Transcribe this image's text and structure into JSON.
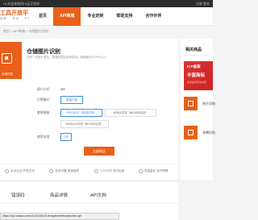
{
  "topbar": {
    "left": "HI,欢迎来到四川云正科技",
    "right": "注册  登录"
  },
  "header": {
    "logo_line1": "工具开放平台",
    "logo_line2": "智能 · 安全 · 开放",
    "nav": [
      {
        "label": "首页"
      },
      {
        "label": "API商城"
      },
      {
        "label": "专业定制"
      },
      {
        "label": "帮助支持"
      },
      {
        "label": "合作伙伴"
      }
    ],
    "active_index": 1
  },
  "breadcrumb": "首页 > API商城 > 仓储图片识别",
  "product": {
    "image_label": "仓储识别",
    "title": "仓储图片识别",
    "desc": "识别一张图片是否，快速处理且简单易用，精确度达99.99%以上",
    "fields": {
      "type_label": "接口方式：",
      "type_value": "API",
      "pay_label": "付费模式：",
      "pay_options": [
        "按量付费"
      ],
      "spec_label": "套餐规格：",
      "spec_options": [
        "0元/100次（免费试用）",
        "90元/1万次（¥0.009元/次）",
        "900元/10万次（¥0.009元/次）"
      ],
      "qty_label": "使用年限：",
      "qty_value": "1年"
    },
    "buy_label": "立即购买"
  },
  "features": [
    {
      "label": "实名认证  开发交流"
    },
    {
      "label": "安全可靠  极速保障"
    },
    {
      "label": "7×24小时  实时运维"
    },
    {
      "label": "流量监控  及时预警"
    }
  ],
  "sidebar": {
    "title": "相关商品",
    "ad": {
      "line1": "ICP备案",
      "line2": "丰富商标",
      "line3": "免费提供营业执照"
    },
    "items": [
      {
        "label": "名片识别"
      },
      {
        "label": "车牌识别"
      }
    ]
  },
  "tabs": [
    {
      "label": "错误码"
    },
    {
      "label": "商品详情"
    },
    {
      "label": "API文档"
    }
  ],
  "status_url": "https://api.cnaaz.com/v1/20240101/imageidentification/sm.api"
}
